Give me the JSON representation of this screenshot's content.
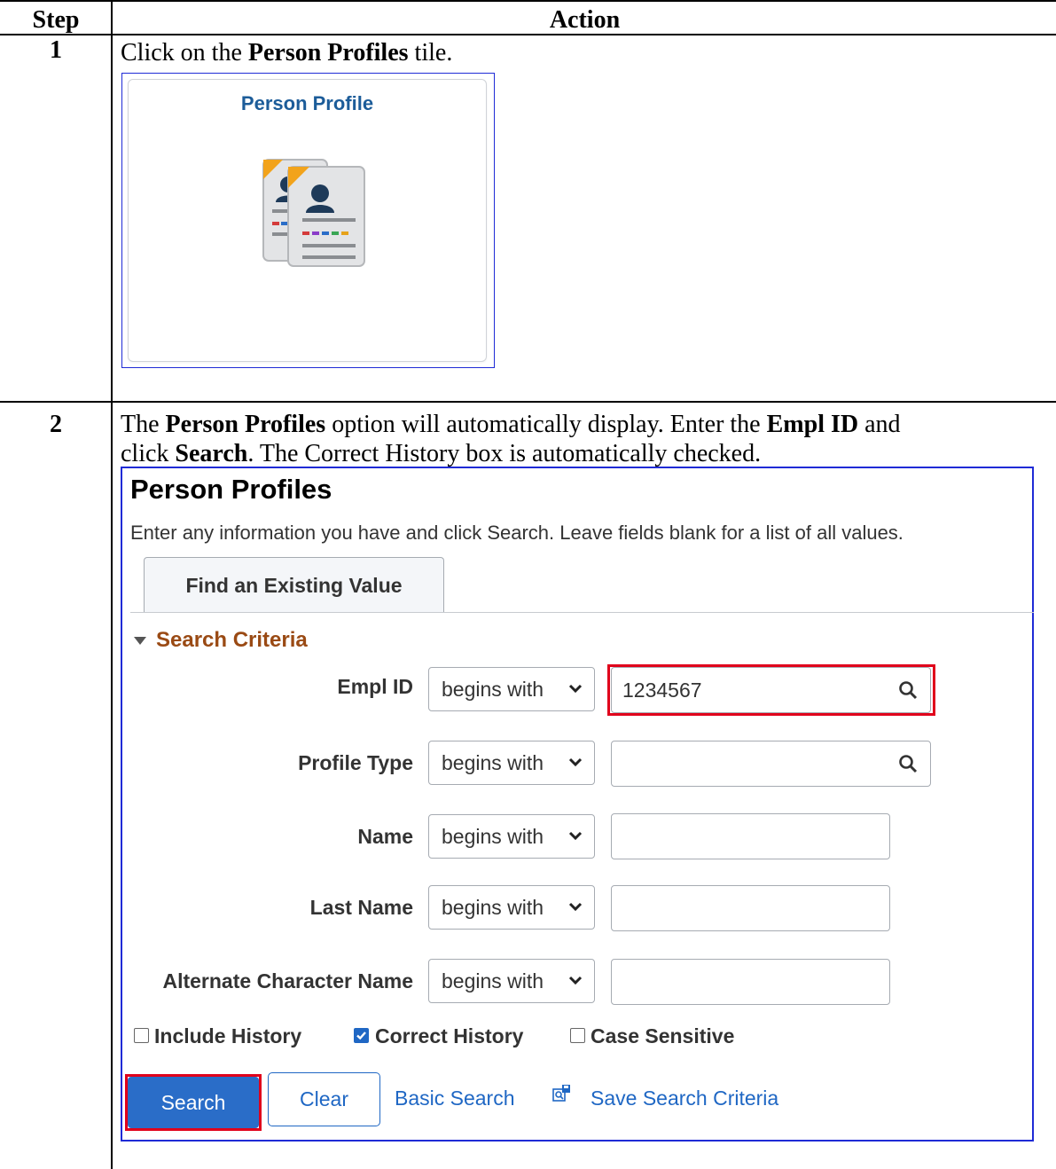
{
  "table": {
    "header_step": "Step",
    "header_action": "Action"
  },
  "step1": {
    "number": "1",
    "instruction_pre": "Click on the ",
    "instruction_bold": "Person Profiles",
    "instruction_post": " tile.",
    "tile_title": "Person Profile",
    "tile_icon": "person-profile-documents-icon"
  },
  "step2": {
    "number": "2",
    "instr_a": "The ",
    "instr_b": "Person Profiles",
    "instr_c": " option will automatically display. Enter the ",
    "instr_d": "Empl ID",
    "instr_e": " and",
    "instr_f": "click ",
    "instr_g": "Search",
    "instr_h": ". The Correct History box is automatically checked."
  },
  "screen": {
    "title": "Person Profiles",
    "description": "Enter any information you have and click Search. Leave fields blank for a list of all values.",
    "tab": "Find an Existing Value",
    "criteria_heading": "Search Criteria",
    "fields": [
      {
        "label": "Empl ID",
        "operator": "begins with",
        "value": "1234567",
        "lookup": true
      },
      {
        "label": "Profile Type",
        "operator": "begins with",
        "value": "",
        "lookup": true
      },
      {
        "label": "Name",
        "operator": "begins with",
        "value": "",
        "lookup": false
      },
      {
        "label": "Last Name",
        "operator": "begins with",
        "value": "",
        "lookup": false
      },
      {
        "label": "Alternate Character Name",
        "operator": "begins with",
        "value": "",
        "lookup": false
      }
    ],
    "checkboxes": [
      {
        "label": "Include History",
        "checked": false
      },
      {
        "label": "Correct History",
        "checked": true
      },
      {
        "label": "Case Sensitive",
        "checked": false
      }
    ],
    "search_button": "Search",
    "clear_button": "Clear",
    "basic_search_link": "Basic Search",
    "save_criteria_link": "Save Search Criteria",
    "accent_color": "#1f67c4",
    "highlight_color": "#e0001b"
  }
}
